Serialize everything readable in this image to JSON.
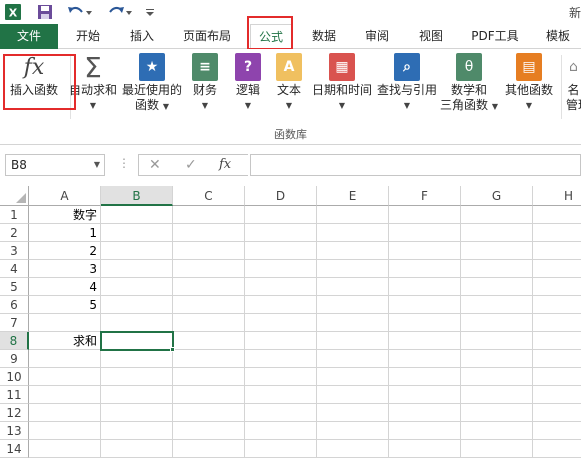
{
  "titlebar": {
    "title": "新"
  },
  "tabs": [
    {
      "label": "文件"
    },
    {
      "label": "开始"
    },
    {
      "label": "插入"
    },
    {
      "label": "页面布局"
    },
    {
      "label": "公式"
    },
    {
      "label": "数据"
    },
    {
      "label": "审阅"
    },
    {
      "label": "视图"
    },
    {
      "label": "PDF工具"
    },
    {
      "label": "模板"
    }
  ],
  "ribbon": {
    "insert_function": {
      "label": "插入函数",
      "icon_glyph": "fx"
    },
    "autosum": {
      "label": "自动求和"
    },
    "recent": {
      "label_line1": "最近使用的",
      "label_line2": "函数"
    },
    "financial": {
      "label": "财务"
    },
    "logical": {
      "label": "逻辑"
    },
    "text": {
      "label": "文本"
    },
    "datetime": {
      "label": "日期和时间"
    },
    "lookup": {
      "label": "查找与引用"
    },
    "math": {
      "label_line1": "数学和",
      "label_line2": "三角函数"
    },
    "more": {
      "label": "其他函数"
    },
    "name_mgr": {
      "label_line1": "名",
      "label_line2": "管理"
    },
    "group_label": "函数库"
  },
  "formula_bar": {
    "name_box": "B8",
    "value": ""
  },
  "grid": {
    "columns": [
      "A",
      "B",
      "C",
      "D",
      "E",
      "F",
      "G",
      "H"
    ],
    "rows": [
      "1",
      "2",
      "3",
      "4",
      "5",
      "6",
      "7",
      "8",
      "9",
      "10",
      "11",
      "12",
      "13",
      "14"
    ],
    "cells": {
      "A1": "数字",
      "A2": "1",
      "A3": "2",
      "A4": "3",
      "A5": "4",
      "A6": "5",
      "A8": "求和"
    },
    "selected_cell": "B8"
  },
  "colors": {
    "accent": "#217346",
    "highlight": "#e32b2b"
  }
}
